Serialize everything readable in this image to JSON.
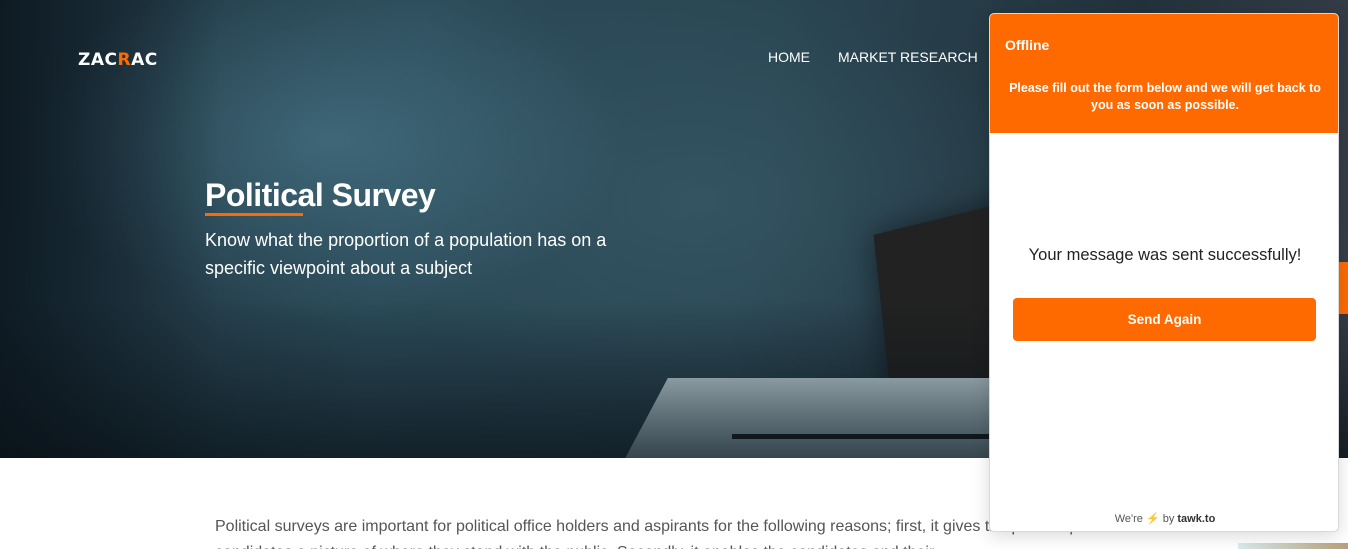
{
  "brand": {
    "logo_part1": "ZAC",
    "logo_accent": "R",
    "logo_part2": "AC"
  },
  "nav": {
    "items": [
      {
        "label": "HOME"
      },
      {
        "label": "MARKET RESEARCH"
      }
    ]
  },
  "hero": {
    "title": "Political Survey",
    "subtitle": "Know what the proportion of a population has on a specific viewpoint about a subject"
  },
  "content": {
    "paragraph": "Political surveys are important for political office holders and aspirants for the following reasons; first, it gives the political parties and their candidates a picture of where they stand with the public. Secondly, it enables the candidates and their"
  },
  "chat": {
    "status": "Offline",
    "description": "Please fill out the form below and we will get back to you as soon as possible.",
    "message": "Your message was sent successfully!",
    "send_again_label": "Send Again",
    "powered_prefix": "We're",
    "powered_by": "by",
    "powered_brand": "tawk.to"
  },
  "colors": {
    "accent": "#ff6a00",
    "text": "#555555"
  },
  "icons": {
    "bolt": "lightning-bolt-icon"
  }
}
